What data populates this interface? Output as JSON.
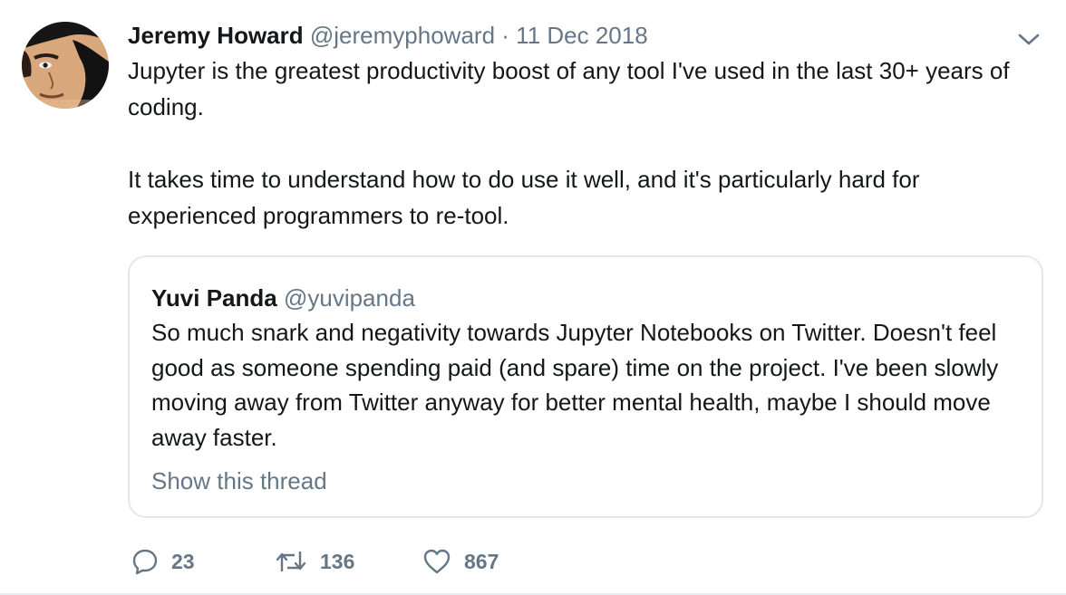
{
  "tweet": {
    "author_name": "Jeremy Howard",
    "author_handle": "@jeremyphoward",
    "separator": "·",
    "date": "11 Dec 2018",
    "text_line_1": "Jupyter is the greatest productivity boost of any tool I've used in the last 30+ years of coding.",
    "text_line_2": "It takes time to understand how to do use it well, and it's particularly hard for experienced programmers to re-tool."
  },
  "quoted_tweet": {
    "author_name": "Yuvi Panda",
    "author_handle": "@yuvipanda",
    "text": "So much snark and negativity towards Jupyter Notebooks on Twitter. Doesn't feel good as someone spending paid (and spare) time on the project. I've been slowly moving away from Twitter anyway for better mental health, maybe I should move away faster.",
    "show_thread": "Show this thread"
  },
  "actions": {
    "replies": "23",
    "retweets": "136",
    "likes": "867"
  },
  "icons": {
    "menu": "chevron-down-icon",
    "reply": "reply-icon",
    "retweet": "retweet-icon",
    "like": "heart-icon"
  },
  "colors": {
    "text": "#14171a",
    "secondary": "#657786",
    "border": "#e1e8ed"
  }
}
